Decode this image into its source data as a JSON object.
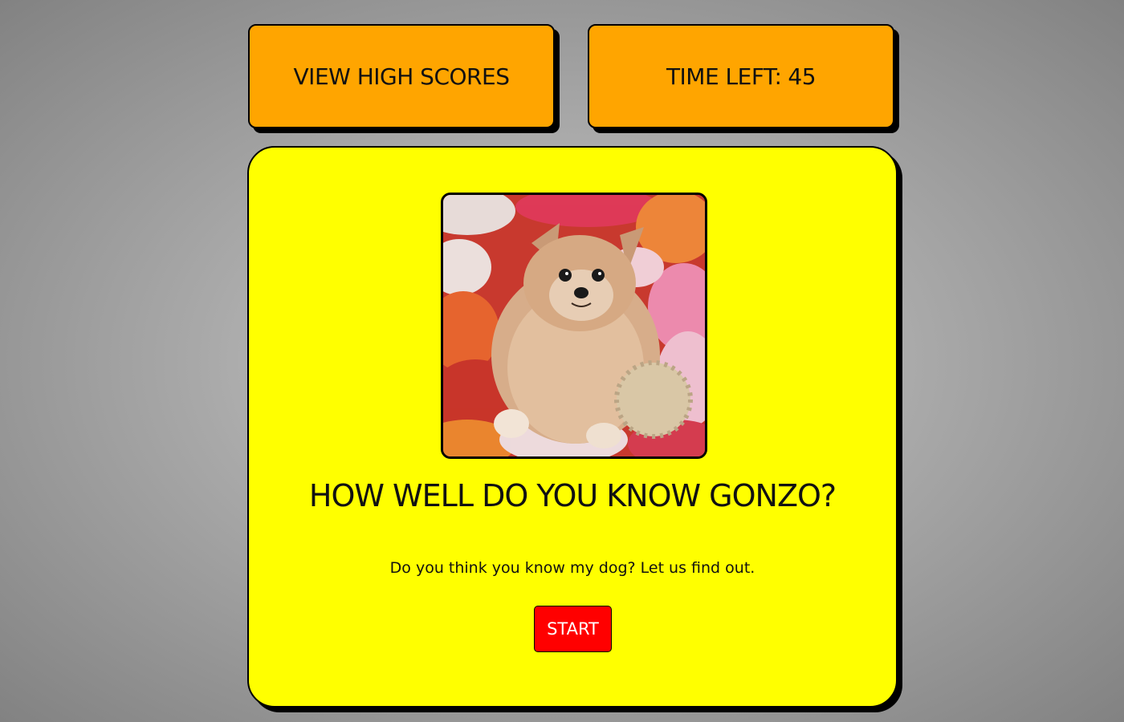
{
  "header": {
    "high_scores_label": "VIEW HIGH SCORES",
    "timer_label": "TIME LEFT:",
    "timer_value": "45"
  },
  "quiz": {
    "photo": {
      "subject": "pomeranian dog on a colorful shag rug",
      "icon": "dog-photo"
    },
    "title": "HOW WELL DO YOU KNOW GONZO?",
    "intro": "Do you think you know my dog? Let us find out.",
    "start_label": "START"
  },
  "colors": {
    "header_boxes": "#ffa500",
    "card": "#ffff00",
    "start_button": "#ff0000",
    "border": "#000000"
  }
}
